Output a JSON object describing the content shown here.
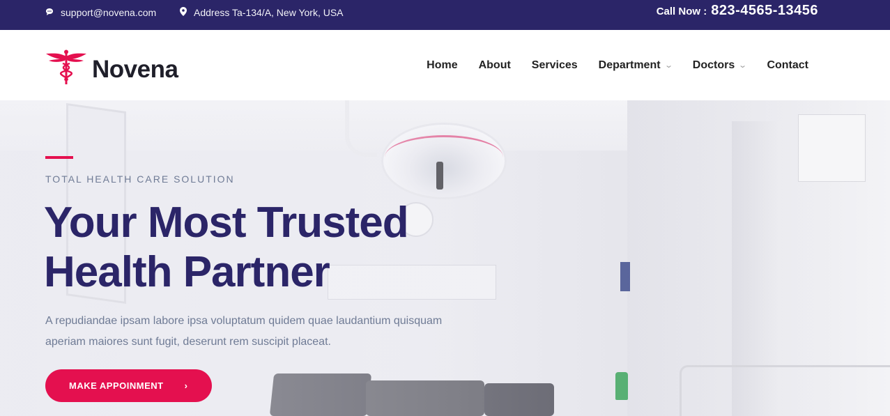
{
  "topbar": {
    "email": "support@novena.com",
    "address": "Address Ta-134/A, New York, USA",
    "call_label": "Call Now :",
    "phone": "823-4565-13456"
  },
  "brand": {
    "name": "Novena",
    "logo_icon": "caduceus-icon",
    "accent_color": "#e4104f"
  },
  "nav": {
    "items": [
      {
        "label": "Home",
        "dropdown": false
      },
      {
        "label": "About",
        "dropdown": false
      },
      {
        "label": "Services",
        "dropdown": false
      },
      {
        "label": "Department",
        "dropdown": true
      },
      {
        "label": "Doctors",
        "dropdown": true
      },
      {
        "label": "Contact",
        "dropdown": false
      }
    ]
  },
  "hero": {
    "kicker": "TOTAL HEALTH CARE SOLUTION",
    "title": "Your Most Trusted Health Partner",
    "description": "A repudiandae ipsam labore ipsa voluptatum quidem quae laudantium quisquam aperiam maiores sunt fugit, deserunt rem suscipit placeat.",
    "cta_label": "MAKE APPOINMENT",
    "cta_icon": "chevron-right-icon"
  },
  "colors": {
    "topbar": "#2b2568",
    "heading": "#2b2568",
    "primary": "#e4104f",
    "muted_text": "#6f7b95"
  }
}
